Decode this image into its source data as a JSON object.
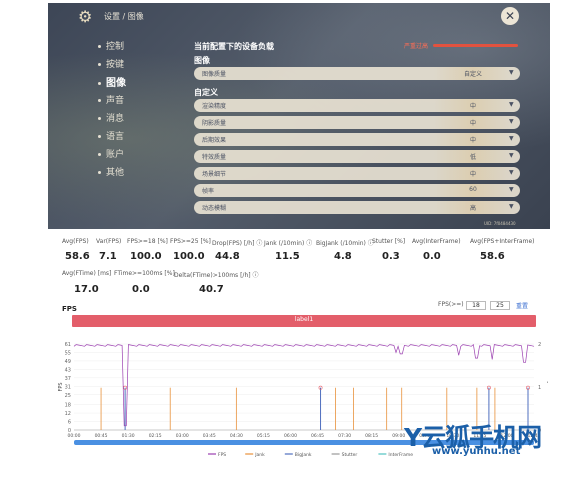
{
  "settings": {
    "breadcrumb": "设置 / 图像",
    "close_symbol": "✕",
    "gear_symbol": "⚙",
    "nav": [
      "控制",
      "按键",
      "图像",
      "声音",
      "消息",
      "语言",
      "账户",
      "其他"
    ],
    "active_nav": "图像",
    "panel_title": "当前配置下的设备负载",
    "load_label": "严重过高",
    "section_image": "图像",
    "section_custom": "自定义",
    "rows": [
      {
        "label": "图像质量",
        "value": "自定义"
      },
      {
        "label": "渲染精度",
        "value": "中"
      },
      {
        "label": "阴影质量",
        "value": "中"
      },
      {
        "label": "后期效果",
        "value": "中"
      },
      {
        "label": "特效质量",
        "value": "低"
      },
      {
        "label": "场景细节",
        "value": "中"
      },
      {
        "label": "帧率",
        "value": "60"
      },
      {
        "label": "动态模糊",
        "value": "高"
      }
    ],
    "uid": "UID: 7f0484430"
  },
  "stats": {
    "row1": [
      {
        "label": "Avg(FPS)",
        "value": "58.6"
      },
      {
        "label": "Var(FPS)",
        "value": "7.1"
      },
      {
        "label": "FPS>=18 [%]",
        "value": "100.0"
      },
      {
        "label": "FPS>=25 [%]",
        "value": "100.0"
      },
      {
        "label": "Drop(FPS) [/h] ⓘ",
        "value": "44.8"
      },
      {
        "label": "Jank (/10min) ⓘ",
        "value": "11.5"
      },
      {
        "label": "BigJank (/10min) ⓘ",
        "value": "4.8"
      },
      {
        "label": "Stutter [%]",
        "value": "0.3"
      },
      {
        "label": "Avg(InterFrame)",
        "value": "0.0"
      },
      {
        "label": "Avg(FPS+InterFrame)",
        "value": "58.6"
      }
    ],
    "row2": [
      {
        "label": "Avg(FTime) [ms]",
        "value": "17.0"
      },
      {
        "label": "FTime>=100ms [%]",
        "value": "0.0"
      },
      {
        "label": "Delta(FTime)>100ms [/h] ⓘ",
        "value": "40.7"
      }
    ]
  },
  "fps_panel": {
    "title": "FPS",
    "range_label": "FPS(>=)",
    "threshold_low": "18",
    "threshold_high": "25",
    "reset_label": "重置",
    "label_bar": "label1"
  },
  "chart_data": {
    "type": "line",
    "y_ticks": [
      0,
      6,
      12,
      18,
      25,
      31,
      37,
      43,
      49,
      55,
      61
    ],
    "y2_ticks": [
      0,
      1,
      2
    ],
    "ylabel": "FPS",
    "y2label": "Jank",
    "x_ticks": [
      "00:00",
      "00:45",
      "01:30",
      "02:15",
      "03:00",
      "03:45",
      "04:30",
      "05:15",
      "06:00",
      "06:45",
      "07:30",
      "08:15",
      "09:00",
      "09:45",
      "10:30",
      "11:15",
      "12:00",
      "12:45"
    ],
    "fps_baseline": 60,
    "fps_dips": [
      {
        "t": "01:25",
        "fps": 3
      },
      {
        "t": "08:55",
        "fps": 55
      },
      {
        "t": "09:05",
        "fps": 54
      },
      {
        "t": "10:40",
        "fps": 53
      },
      {
        "t": "11:10",
        "fps": 51
      },
      {
        "t": "11:35",
        "fps": 50
      },
      {
        "t": "12:30",
        "fps": 48
      }
    ],
    "jank_times": [
      "00:45",
      "02:40",
      "04:30",
      "07:15",
      "07:45",
      "08:40",
      "09:05",
      "10:20",
      "11:10",
      "11:40"
    ],
    "bigjank_times": [
      "01:25",
      "06:50",
      "11:30",
      "12:35"
    ],
    "legend": [
      "FPS",
      "Jank",
      "BigJank",
      "Stutter",
      "InterFrame"
    ],
    "legend_colors": [
      "#9b3fb0",
      "#e8913a",
      "#4f6fbf",
      "#999999",
      "#4fc3c0"
    ]
  },
  "watermark": {
    "text": "Y云狐手机网",
    "url": "www.yunhu.net"
  }
}
